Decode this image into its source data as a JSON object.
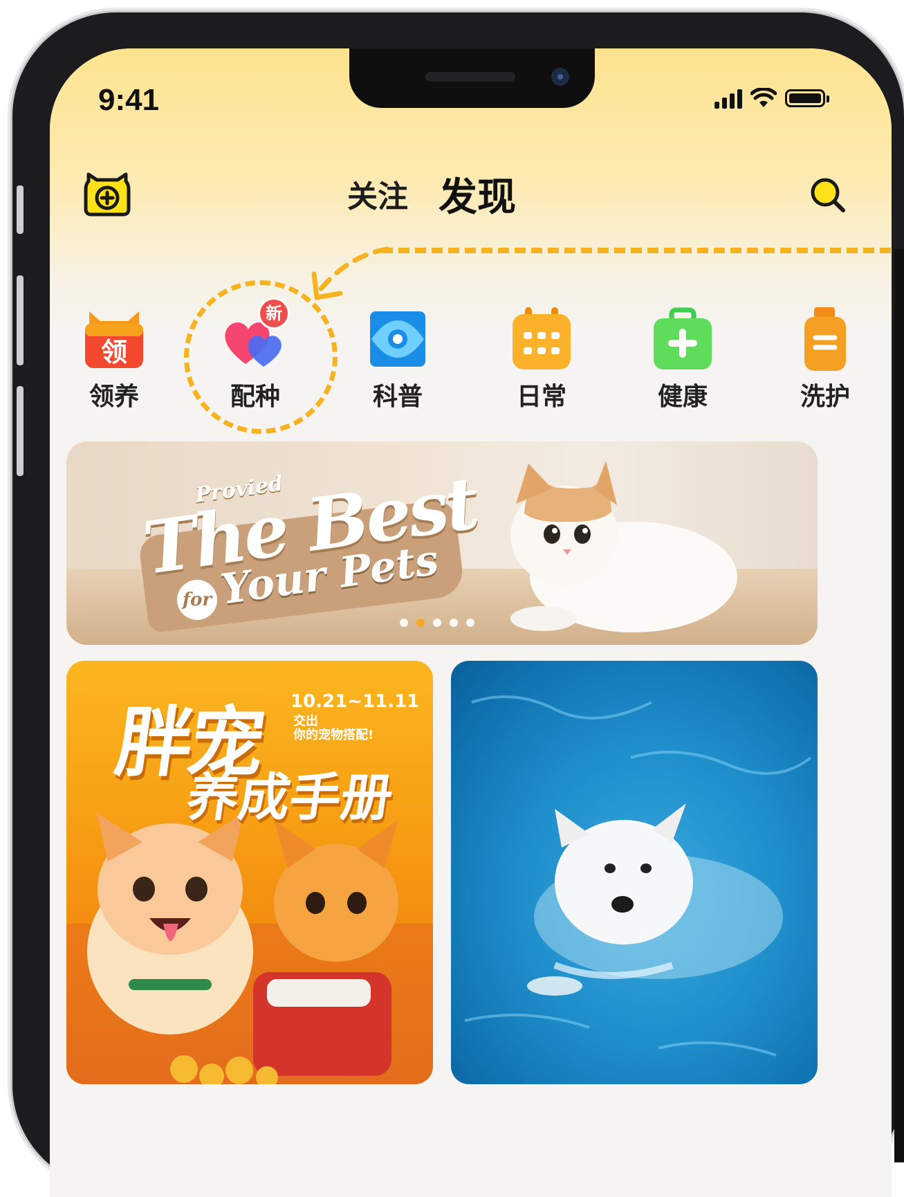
{
  "status_bar": {
    "time": "9:41"
  },
  "nav": {
    "tabs": [
      {
        "label": "关注",
        "active": false
      },
      {
        "label": "发现",
        "active": true
      }
    ]
  },
  "categories": [
    {
      "label": "领养",
      "icon": "adoption-calendar-icon",
      "badge_text": "领"
    },
    {
      "label": "配种",
      "icon": "breeding-hearts-icon",
      "badge": "新"
    },
    {
      "label": "科普",
      "icon": "science-eye-icon"
    },
    {
      "label": "日常",
      "icon": "daily-calendar-icon"
    },
    {
      "label": "健康",
      "icon": "health-kit-icon"
    },
    {
      "label": "洗护",
      "icon": "grooming-bottle-icon"
    }
  ],
  "banner": {
    "subtitle": "Provied",
    "title": "The Best",
    "for": "for",
    "tagline": "Your Pets",
    "slides_total": 5,
    "active_slide": 2
  },
  "feed": {
    "left_card": {
      "title": "胖宠",
      "subtitle": "养成手册",
      "date": "10.21~11.11",
      "small_line1": "交出",
      "small_line2": "你的宠物搭配!"
    },
    "right_card": {
      "image": "swimming-dog-photo"
    }
  },
  "colors": {
    "accent_yellow": "#fde21a",
    "dashed_annotation": "#f6b21f",
    "active_dot": "#f6a61b"
  }
}
